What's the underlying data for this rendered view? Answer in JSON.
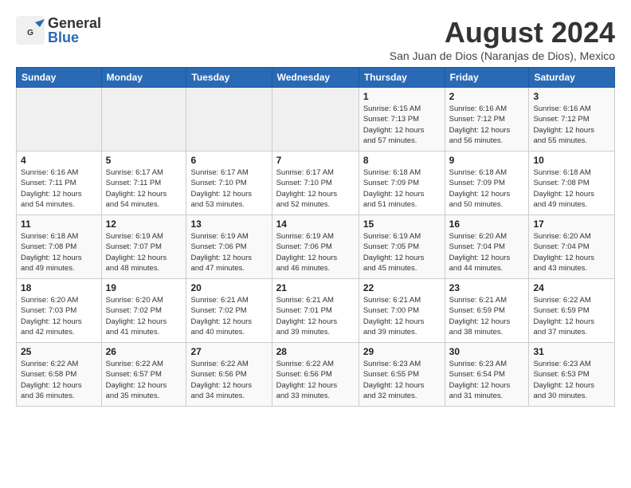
{
  "header": {
    "logo_general": "General",
    "logo_blue": "Blue",
    "month_year": "August 2024",
    "location": "San Juan de Dios (Naranjas de Dios), Mexico"
  },
  "days_of_week": [
    "Sunday",
    "Monday",
    "Tuesday",
    "Wednesday",
    "Thursday",
    "Friday",
    "Saturday"
  ],
  "weeks": [
    [
      {
        "day": "",
        "info": ""
      },
      {
        "day": "",
        "info": ""
      },
      {
        "day": "",
        "info": ""
      },
      {
        "day": "",
        "info": ""
      },
      {
        "day": "1",
        "info": "Sunrise: 6:15 AM\nSunset: 7:13 PM\nDaylight: 12 hours\nand 57 minutes."
      },
      {
        "day": "2",
        "info": "Sunrise: 6:16 AM\nSunset: 7:12 PM\nDaylight: 12 hours\nand 56 minutes."
      },
      {
        "day": "3",
        "info": "Sunrise: 6:16 AM\nSunset: 7:12 PM\nDaylight: 12 hours\nand 55 minutes."
      }
    ],
    [
      {
        "day": "4",
        "info": "Sunrise: 6:16 AM\nSunset: 7:11 PM\nDaylight: 12 hours\nand 54 minutes."
      },
      {
        "day": "5",
        "info": "Sunrise: 6:17 AM\nSunset: 7:11 PM\nDaylight: 12 hours\nand 54 minutes."
      },
      {
        "day": "6",
        "info": "Sunrise: 6:17 AM\nSunset: 7:10 PM\nDaylight: 12 hours\nand 53 minutes."
      },
      {
        "day": "7",
        "info": "Sunrise: 6:17 AM\nSunset: 7:10 PM\nDaylight: 12 hours\nand 52 minutes."
      },
      {
        "day": "8",
        "info": "Sunrise: 6:18 AM\nSunset: 7:09 PM\nDaylight: 12 hours\nand 51 minutes."
      },
      {
        "day": "9",
        "info": "Sunrise: 6:18 AM\nSunset: 7:09 PM\nDaylight: 12 hours\nand 50 minutes."
      },
      {
        "day": "10",
        "info": "Sunrise: 6:18 AM\nSunset: 7:08 PM\nDaylight: 12 hours\nand 49 minutes."
      }
    ],
    [
      {
        "day": "11",
        "info": "Sunrise: 6:18 AM\nSunset: 7:08 PM\nDaylight: 12 hours\nand 49 minutes."
      },
      {
        "day": "12",
        "info": "Sunrise: 6:19 AM\nSunset: 7:07 PM\nDaylight: 12 hours\nand 48 minutes."
      },
      {
        "day": "13",
        "info": "Sunrise: 6:19 AM\nSunset: 7:06 PM\nDaylight: 12 hours\nand 47 minutes."
      },
      {
        "day": "14",
        "info": "Sunrise: 6:19 AM\nSunset: 7:06 PM\nDaylight: 12 hours\nand 46 minutes."
      },
      {
        "day": "15",
        "info": "Sunrise: 6:19 AM\nSunset: 7:05 PM\nDaylight: 12 hours\nand 45 minutes."
      },
      {
        "day": "16",
        "info": "Sunrise: 6:20 AM\nSunset: 7:04 PM\nDaylight: 12 hours\nand 44 minutes."
      },
      {
        "day": "17",
        "info": "Sunrise: 6:20 AM\nSunset: 7:04 PM\nDaylight: 12 hours\nand 43 minutes."
      }
    ],
    [
      {
        "day": "18",
        "info": "Sunrise: 6:20 AM\nSunset: 7:03 PM\nDaylight: 12 hours\nand 42 minutes."
      },
      {
        "day": "19",
        "info": "Sunrise: 6:20 AM\nSunset: 7:02 PM\nDaylight: 12 hours\nand 41 minutes."
      },
      {
        "day": "20",
        "info": "Sunrise: 6:21 AM\nSunset: 7:02 PM\nDaylight: 12 hours\nand 40 minutes."
      },
      {
        "day": "21",
        "info": "Sunrise: 6:21 AM\nSunset: 7:01 PM\nDaylight: 12 hours\nand 39 minutes."
      },
      {
        "day": "22",
        "info": "Sunrise: 6:21 AM\nSunset: 7:00 PM\nDaylight: 12 hours\nand 39 minutes."
      },
      {
        "day": "23",
        "info": "Sunrise: 6:21 AM\nSunset: 6:59 PM\nDaylight: 12 hours\nand 38 minutes."
      },
      {
        "day": "24",
        "info": "Sunrise: 6:22 AM\nSunset: 6:59 PM\nDaylight: 12 hours\nand 37 minutes."
      }
    ],
    [
      {
        "day": "25",
        "info": "Sunrise: 6:22 AM\nSunset: 6:58 PM\nDaylight: 12 hours\nand 36 minutes."
      },
      {
        "day": "26",
        "info": "Sunrise: 6:22 AM\nSunset: 6:57 PM\nDaylight: 12 hours\nand 35 minutes."
      },
      {
        "day": "27",
        "info": "Sunrise: 6:22 AM\nSunset: 6:56 PM\nDaylight: 12 hours\nand 34 minutes."
      },
      {
        "day": "28",
        "info": "Sunrise: 6:22 AM\nSunset: 6:56 PM\nDaylight: 12 hours\nand 33 minutes."
      },
      {
        "day": "29",
        "info": "Sunrise: 6:23 AM\nSunset: 6:55 PM\nDaylight: 12 hours\nand 32 minutes."
      },
      {
        "day": "30",
        "info": "Sunrise: 6:23 AM\nSunset: 6:54 PM\nDaylight: 12 hours\nand 31 minutes."
      },
      {
        "day": "31",
        "info": "Sunrise: 6:23 AM\nSunset: 6:53 PM\nDaylight: 12 hours\nand 30 minutes."
      }
    ]
  ]
}
